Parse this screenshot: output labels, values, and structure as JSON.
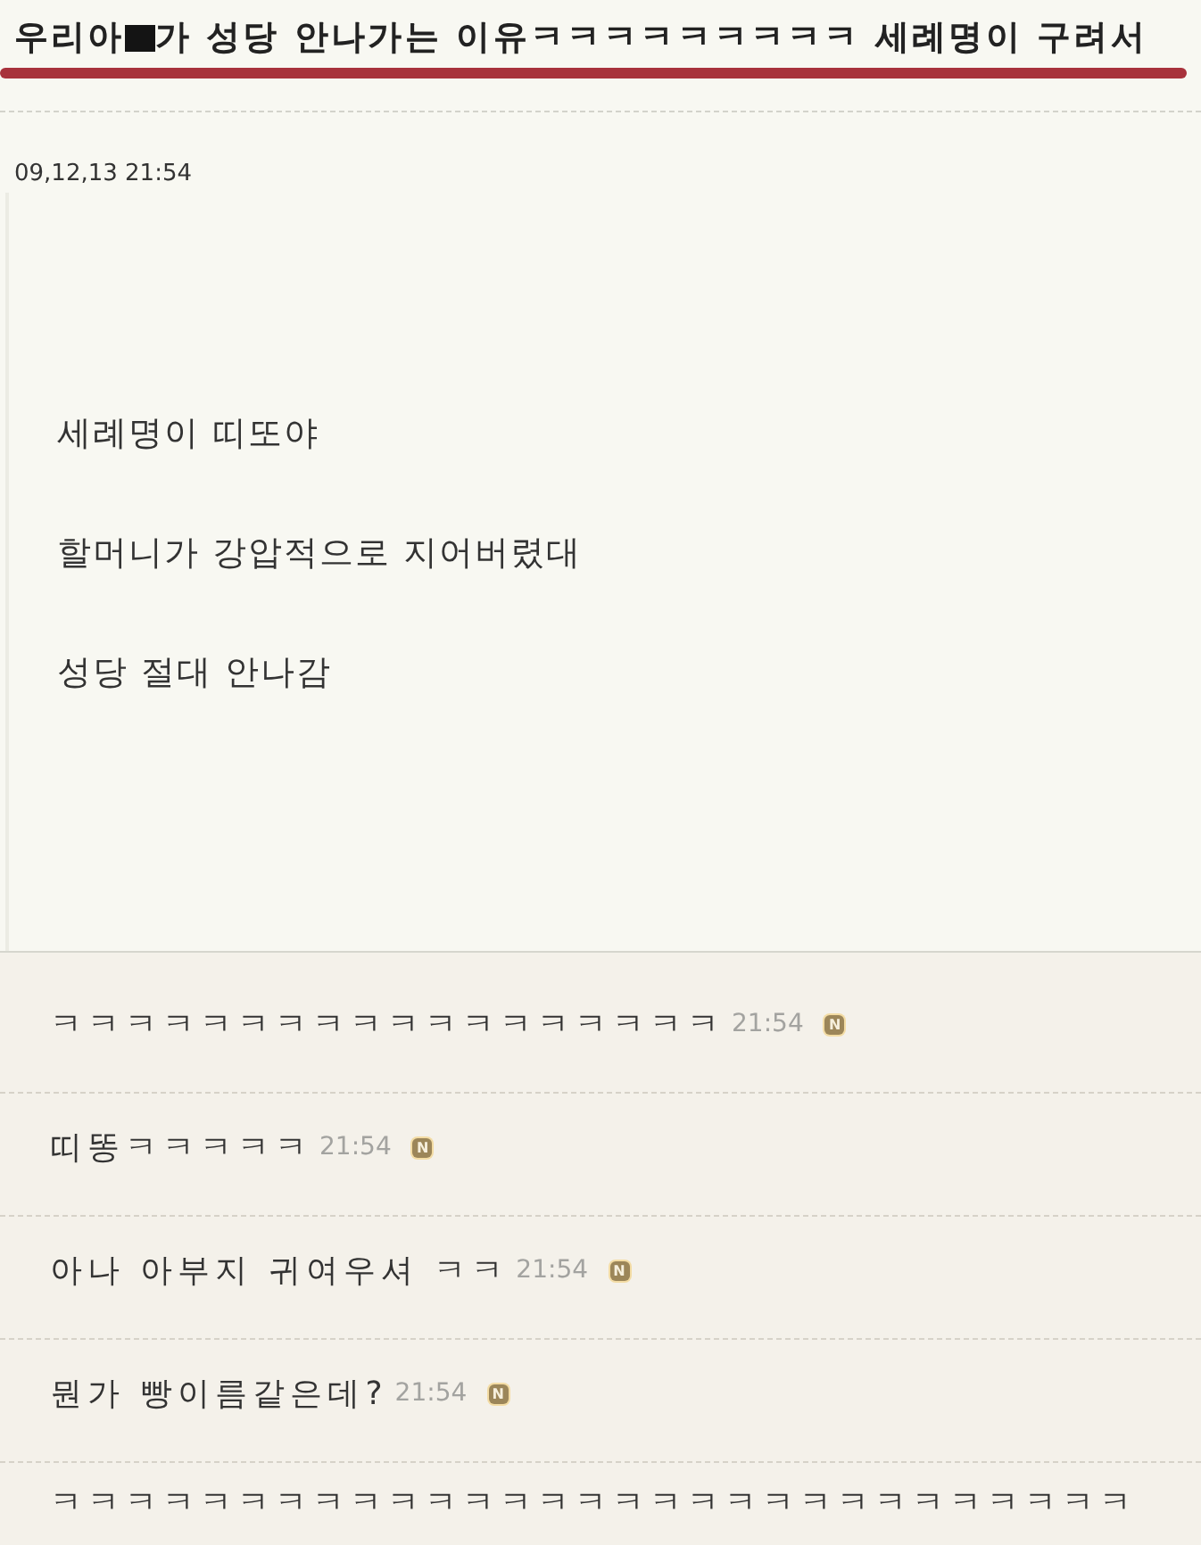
{
  "post": {
    "title_parts": [
      {
        "kind": "text",
        "text": "우리아"
      },
      {
        "kind": "censored"
      },
      {
        "kind": "text",
        "text": "가 성당 안나가는 이유ㅋㅋㅋㅋㅋㅋㅋㅋㅋ 세례명이 구려서"
      }
    ],
    "date": "09,12,13 21:54"
  },
  "body": {
    "lines": [
      "세례명이 띠또야",
      "할머니가 강압적으로 지어버렸대",
      "성당 절대 안나감"
    ]
  },
  "comments": [
    {
      "text": "ㅋㅋㅋㅋㅋㅋㅋㅋㅋㅋㅋㅋㅋㅋㅋㅋㅋㅋ",
      "time": "21:54",
      "badge": "N"
    },
    {
      "text": "띠똥ㅋㅋㅋㅋㅋ",
      "time": "21:54",
      "badge": "N"
    },
    {
      "text": "아나 아부지 귀여우셔 ㅋㅋ",
      "time": "21:54",
      "badge": "N"
    },
    {
      "text": "뭔가 빵이름같은데?",
      "time": "21:54",
      "badge": "N"
    },
    {
      "text": "ㅋㅋㅋㅋㅋㅋㅋㅋㅋㅋㅋㅋㅋㅋㅋㅋㅋㅋㅋㅋㅋㅋㅋㅋㅋㅋㅋㅋㅋ"
    }
  ]
}
